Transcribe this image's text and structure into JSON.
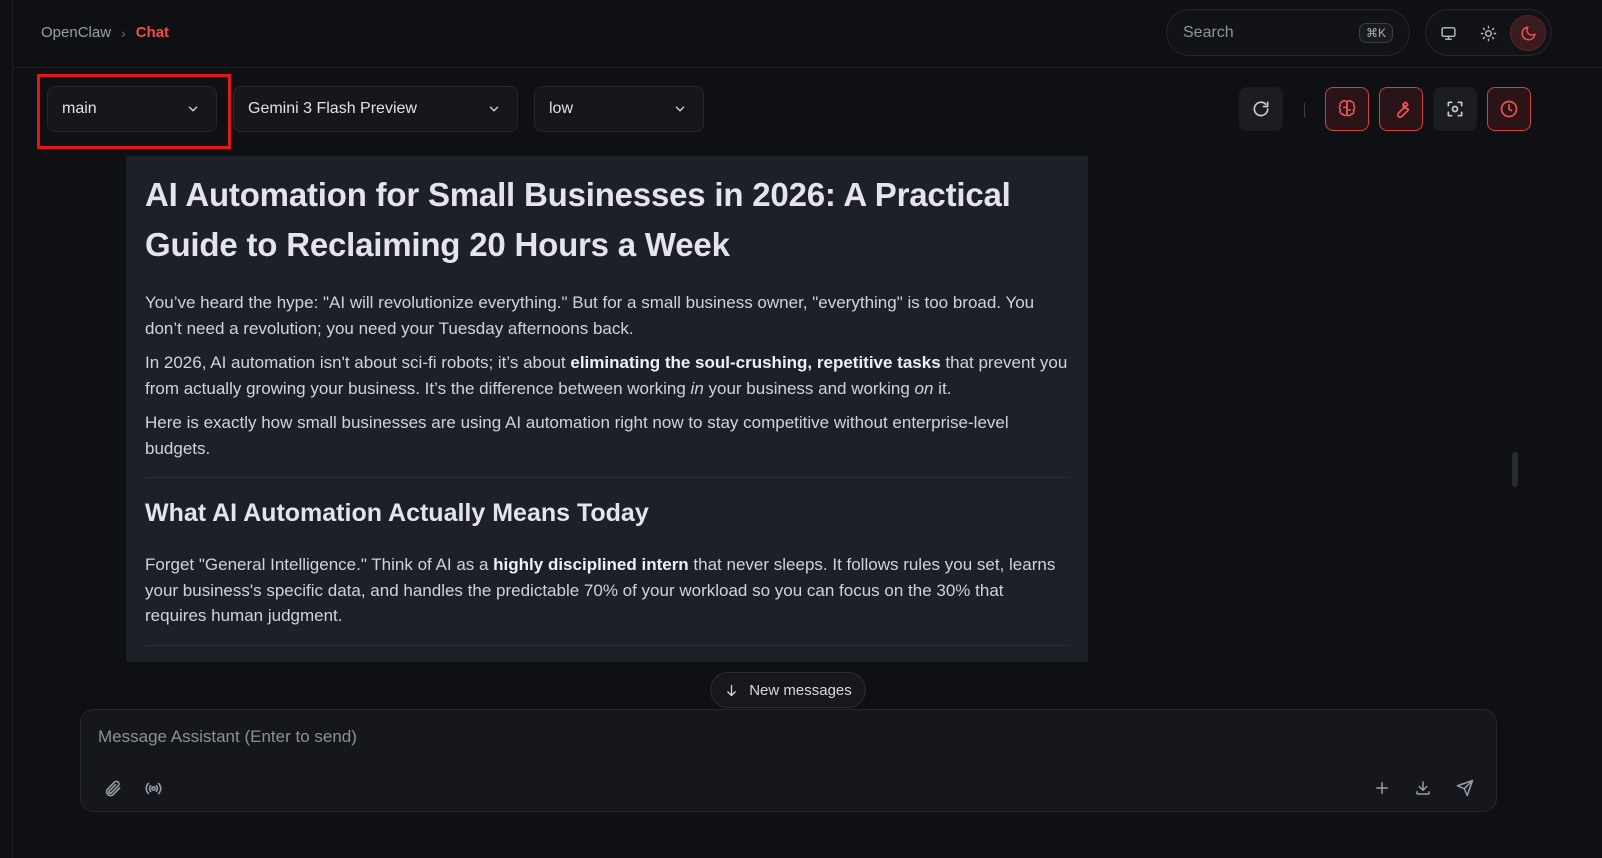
{
  "breadcrumb": {
    "root": "OpenClaw",
    "separator": "›",
    "current": "Chat"
  },
  "search": {
    "placeholder": "Search",
    "shortcut": "⌘K"
  },
  "theme": {
    "options": [
      "monitor-icon",
      "sun-icon",
      "moon-icon"
    ],
    "active": "moon-icon"
  },
  "selectors": {
    "session": "main",
    "model": "Gemini 3 Flash Preview",
    "thinking": "low"
  },
  "toolbar": {
    "icons": [
      "refresh-icon",
      "brain-icon",
      "wrench-icon",
      "focus-icon",
      "clock-icon"
    ],
    "divider": "|"
  },
  "message": {
    "title": "AI Automation for Small Businesses in 2026: A Practical Guide to Reclaiming 20 Hours a Week",
    "p1": "You’ve heard the hype: \"AI will revolutionize everything.\" But for a small business owner, \"everything\" is too broad. You don’t need a revolution; you need your Tuesday afternoons back.",
    "p2_a": "In 2026, AI automation isn't about sci-fi robots; it’s about ",
    "p2_b": "eliminating the soul-crushing, repetitive tasks",
    "p2_c": " that prevent you from actually growing your business. It’s the difference between working ",
    "p2_d": "in",
    "p2_e": " your business and working ",
    "p2_f": "on",
    "p2_g": " it.",
    "p3": "Here is exactly how small businesses are using AI automation right now to stay competitive without enterprise-level budgets.",
    "h2": "What AI Automation Actually Means Today",
    "p4_a": "Forget \"General Intelligence.\" Think of AI as a ",
    "p4_b": "highly disciplined intern",
    "p4_c": " that never sleeps. It follows rules you set, learns your business's specific data, and handles the predictable 70% of your workload so you can focus on the 30% that requires human judgment."
  },
  "new_messages": {
    "label": "New messages"
  },
  "composer": {
    "placeholder": "Message Assistant (Enter to send)",
    "left_icons": [
      "paperclip-icon",
      "broadcast-icon"
    ],
    "right_icons": [
      "plus-icon",
      "download-icon",
      "send-icon"
    ]
  },
  "colors": {
    "accent": "#ef4b4b",
    "background": "#0f1014",
    "card": "#1d2029",
    "highlight_box": "#e01818"
  }
}
